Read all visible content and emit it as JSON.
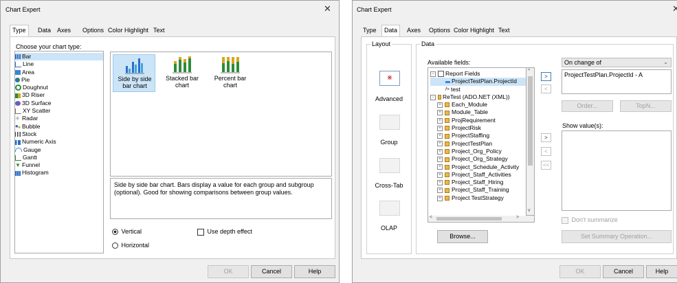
{
  "left_dialog": {
    "title": "Chart Expert",
    "tabs": [
      "Type",
      "Data",
      "Axes",
      "Options",
      "Color Highlight",
      "Text"
    ],
    "choose_label": "Choose your chart type:",
    "chart_types": [
      "Bar",
      "Line",
      "Area",
      "Pie",
      "Doughnut",
      "3D Riser",
      "3D Surface",
      "XY Scatter",
      "Radar",
      "Bubble",
      "Stock",
      "Numeric Axis",
      "Gauge",
      "Gantt",
      "Funnel",
      "Histogram"
    ],
    "subtypes": {
      "side": "Side by side bar chart",
      "stacked": "Stacked bar chart",
      "percent": "Percent bar chart"
    },
    "description": "Side by side bar chart. Bars display a value for each group and subgroup (optional). Good for showing comparisons between group values.",
    "vertical_label": "Vertical",
    "horizontal_label": "Horizontal",
    "depth_label": "Use depth effect",
    "ok": "OK",
    "cancel": "Cancel",
    "help": "Help"
  },
  "right_dialog": {
    "title": "Chart Expert",
    "tabs": [
      "Type",
      "Data",
      "Axes",
      "Options",
      "Color Highlight",
      "Text"
    ],
    "layout_label": "Layout",
    "data_label": "Data",
    "layouts": {
      "advanced": "Advanced",
      "group": "Group",
      "crosstab": "Cross-Tab",
      "olap": "OLAP"
    },
    "available_label": "Available fields:",
    "fields": {
      "report_fields": "Report Fields",
      "project_id": "ProjectTestPlan.ProjectId",
      "test": "test",
      "retest": "ReTest (ADO.NET (XML))",
      "tables": [
        "Each_Module",
        "Module_Table",
        "ProjRequirement",
        "ProjectRisk",
        "ProjectStaffing",
        "ProjectTestPlan",
        "Project_Org_Policy",
        "Project_Org_Strategy",
        "Project_Schedule_Activity",
        "Project_Staff_Activities",
        "Project_Staff_Hiring",
        "Project_Staff_Training",
        "Project TestStrategy"
      ]
    },
    "on_change_value": "On change of",
    "on_change_field": "ProjectTestPlan.ProjectId - A",
    "order": "Order...",
    "topn": "TopN...",
    "show_values_label": "Show value(s):",
    "dont_summarize": "Don't summarize",
    "browse": "Browse...",
    "set_summary": "Set Summary Operation...",
    "ok": "OK",
    "cancel": "Cancel",
    "help": "Help"
  }
}
